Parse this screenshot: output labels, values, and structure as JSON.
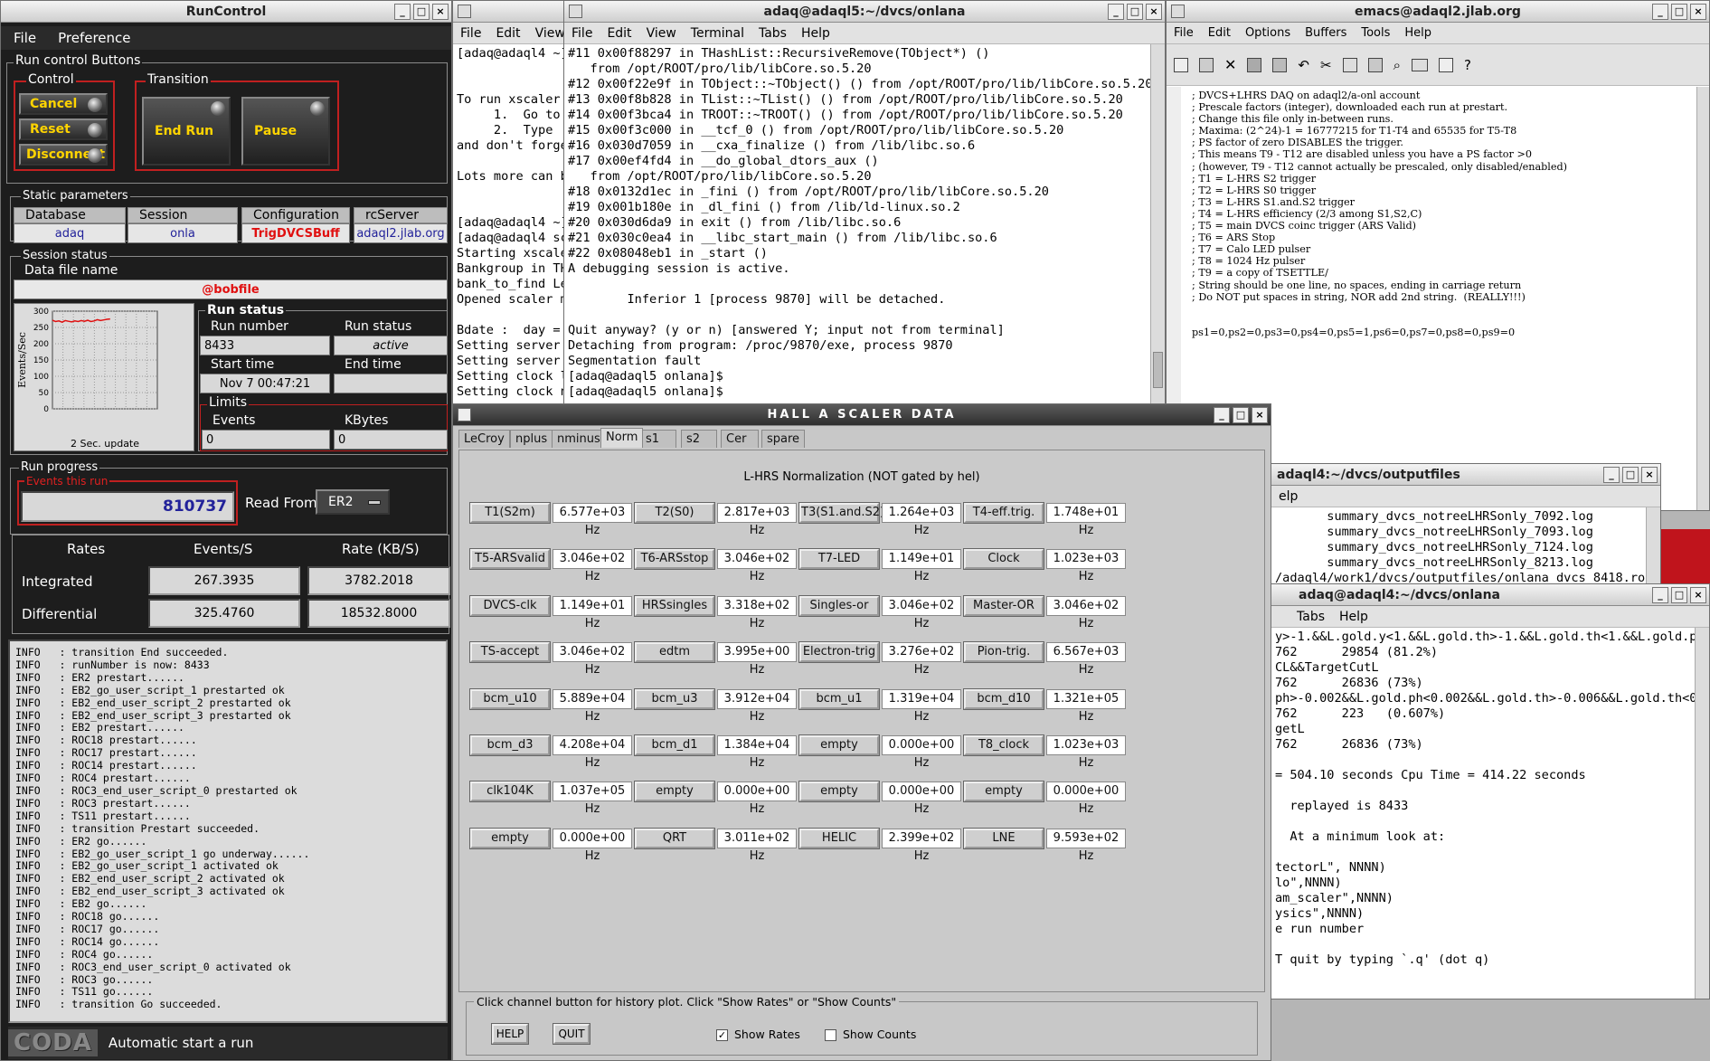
{
  "runcontrol": {
    "title": "RunControl",
    "menu": [
      "File",
      "Preference"
    ],
    "control_buttons_label": "Run control Buttons",
    "control_label": "Control",
    "transition_label": "Transition",
    "cancel": "Cancel",
    "reset": "Reset",
    "disconnect": "Disconnect",
    "end_run": "End Run",
    "pause": "Pause",
    "static_label": "Static parameters",
    "static_headers": [
      "Database",
      "Session",
      "Configuration",
      "rcServer"
    ],
    "static_values": [
      "adaq",
      "onla",
      "TrigDVCSBuff",
      "adaql2.jlab.org"
    ],
    "session_status": "Session status",
    "data_file_label": "Data file name",
    "data_file": "@bobfile",
    "chart_update": "2 Sec. update",
    "run_status_label": "Run status",
    "run_number_label": "Run number",
    "run_number": "8433",
    "run_status_hdr": "Run status",
    "run_status": "active",
    "start_time_label": "Start time",
    "start_time": "Nov 7 00:47:21",
    "end_time_label": "End time",
    "end_time": "",
    "limits_label": "Limits",
    "events_label": "Events",
    "events_val": "0",
    "kbytes_label": "KBytes",
    "kbytes_val": "0",
    "run_progress": "Run progress",
    "events_this_run_label": "Events this run",
    "events_this_run": "810737",
    "read_from_label": "Read From:",
    "read_from": "ER2",
    "rates_hdr": [
      "Rates",
      "Events/S",
      "Rate (KB/S)"
    ],
    "integrated": {
      "label": "Integrated",
      "events": "267.3935",
      "rate": "3782.2018"
    },
    "differential": {
      "label": "Differential",
      "events": "325.4760",
      "rate": "18532.8000"
    },
    "log": [
      "INFO   : transition End succeeded.",
      "INFO   : runNumber is now: 8433",
      "INFO   : ER2 prestart......",
      "INFO   : EB2_go_user_script_1 prestarted ok",
      "INFO   : EB2_end_user_script_2 prestarted ok",
      "INFO   : EB2_end_user_script_3 prestarted ok",
      "INFO   : EB2 prestart......",
      "INFO   : ROC18 prestart......",
      "INFO   : ROC17 prestart......",
      "INFO   : ROC14 prestart......",
      "INFO   : ROC4 prestart......",
      "INFO   : ROC3_end_user_script_0 prestarted ok",
      "INFO   : ROC3 prestart......",
      "INFO   : TS11 prestart......",
      "INFO   : transition Prestart succeeded.",
      "INFO   : ER2 go......",
      "INFO   : EB2_go_user_script_1 go underway......",
      "INFO   : EB2_go_user_script_1 activated ok",
      "INFO   : EB2_end_user_script_2 activated ok",
      "INFO   : EB2_end_user_script_3 activated ok",
      "INFO   : EB2 go......",
      "INFO   : ROC18 go......",
      "INFO   : ROC17 go......",
      "INFO   : ROC14 go......",
      "INFO   : ROC4 go......",
      "INFO   : ROC3_end_user_script_0 activated ok",
      "INFO   : ROC3 go......",
      "INFO   : TS11 go......",
      "INFO   : transition Go succeeded."
    ],
    "coda": "CODA",
    "status_msg": "Automatic start a run"
  },
  "chart_data": {
    "type": "line",
    "ylabel": "Events/Sec",
    "xlabel": "2 Sec. update",
    "ylim": [
      0,
      300
    ],
    "yticks": [
      "300",
      "250",
      "200",
      "150",
      "100",
      "50",
      "0"
    ],
    "series": [
      {
        "values": [
          272,
          268,
          270,
          266,
          271,
          269,
          267,
          270,
          268,
          271,
          269,
          272,
          268,
          270,
          274,
          271,
          273,
          275,
          276
        ]
      }
    ]
  },
  "term_bg": {
    "title": "",
    "menu": [
      "File",
      "Edit",
      "View"
    ],
    "lines": [
      "[adaq@adaql4 ~]",
      "",
      "",
      "To run xscaler",
      "     1.  Go to",
      "     2.  Type '",
      "and don't forge",
      "",
      "Lots more can b",
      "",
      "",
      "[adaq@adaql4 ~]",
      "[adaq@adaql4 sc",
      "Starting xscale",
      "Bankgroup in TH",
      "bank_to_find Le",
      "Opened scaler m",
      "",
      "Bdate :  day =",
      "Setting server",
      "Setting server",
      "Setting clock l",
      "Setting clock n"
    ]
  },
  "term_main": {
    "title": "adaq@adaql5:~/dvcs/onlana",
    "menu": [
      "File",
      "Edit",
      "View",
      "Terminal",
      "Tabs",
      "Help"
    ],
    "lines": [
      "#11 0x00f88297 in THashList::RecursiveRemove(TObject*) ()",
      "   from /opt/ROOT/pro/lib/libCore.so.5.20",
      "#12 0x00f22e9f in TObject::~TObject() () from /opt/ROOT/pro/lib/libCore.so.5.20",
      "#13 0x00f8b828 in TList::~TList() () from /opt/ROOT/pro/lib/libCore.so.5.20",
      "#14 0x00f3bca4 in TROOT::~TROOT() () from /opt/ROOT/pro/lib/libCore.so.5.20",
      "#15 0x00f3c000 in __tcf_0 () from /opt/ROOT/pro/lib/libCore.so.5.20",
      "#16 0x030d7059 in __cxa_finalize () from /lib/libc.so.6",
      "#17 0x00ef4fd4 in __do_global_dtors_aux ()",
      "   from /opt/ROOT/pro/lib/libCore.so.5.20",
      "#18 0x0132d1ec in _fini () from /opt/ROOT/pro/lib/libCore.so.5.20",
      "#19 0x001b180e in _dl_fini () from /lib/ld-linux.so.2",
      "#20 0x030d6da9 in exit () from /lib/libc.so.6",
      "#21 0x030c0ea4 in __libc_start_main () from /lib/libc.so.6",
      "#22 0x08048eb1 in _start ()",
      "A debugging session is active.",
      "",
      "        Inferior 1 [process 9870] will be detached.",
      "",
      "Quit anyway? (y or n) [answered Y; input not from terminal]",
      "Detaching from program: /proc/9870/exe, process 9870",
      "Segmentation fault",
      "[adaq@adaql5 onlana]$",
      "[adaq@adaql5 onlana]$"
    ]
  },
  "emacs": {
    "title": "emacs@adaql2.jlab.org",
    "menu": [
      "File",
      "Edit",
      "Options",
      "Buffers",
      "Tools",
      "Help"
    ],
    "lines": [
      "; DVCS+LHRS DAQ on adaql2/a-onl account",
      "; Prescale factors (integer), downloaded each run at prestart.",
      "; Change this file only in-between runs.",
      "; Maxima: (2^24)-1 = 16777215 for T1-T4 and 65535 for T5-T8",
      "; PS factor of zero DISABLES the trigger.",
      "; This means T9 - T12 are disabled unless you have a PS factor >0",
      "; (however, T9 - T12 cannot actually be prescaled, only disabled/enabled)",
      "; T1 = L-HRS S2 trigger",
      "; T2 = L-HRS S0 trigger",
      "; T3 = L-HRS S1.and.S2 trigger",
      "; T4 = L-HRS efficiency (2/3 among S1,S2,C)",
      "; T5 = main DVCS coinc trigger (ARS Valid)",
      "; T6 = ARS Stop",
      "; T7 = Calo LED pulser",
      "; T8 = 1024 Hz pulser",
      "; T9 = a copy of TSETTLE/",
      "; String should be one line, no spaces, ending in carriage return",
      "; Do NOT put spaces in string, NOR add 2nd string.  (REALLY!!!)",
      "",
      "",
      "ps1=0,ps2=0,ps3=0,ps4=0,ps5=1,ps6=0,ps7=0,ps8=0,ps9=0"
    ]
  },
  "outputfiles": {
    "title": "adaql4:~/dvcs/outputfiles",
    "menu": [
      "elp"
    ],
    "lines": [
      "       summary_dvcs_notreeLHRSonly_7092.log",
      "       summary_dvcs_notreeLHRSonly_7093.log",
      "       summary_dvcs_notreeLHRSonly_7124.log",
      "       summary_dvcs_notreeLHRSonly_8213.log",
      "/adaql4/work1/dvcs/outputfiles/onlana_dvcs_8418.ro"
    ]
  },
  "term_right": {
    "title": "adaq@adaql4:~/dvcs/onlana",
    "menu": [
      "Tabs",
      "Help"
    ],
    "lines": [
      "y>-1.&&L.gold.y<1.&&L.gold.th>-1.&&L.gold.th<1.&&L.gold.ph",
      "762      29854 (81.2%)",
      "CL&&TargetCutL",
      "762      26836 (73%)",
      "ph>-0.002&&L.gold.ph<0.002&&L.gold.th>-0.006&&L.gold.th<0.",
      "762      223   (0.607%)",
      "getL",
      "762      26836 (73%)",
      "",
      "= 504.10 seconds Cpu Time = 414.22 seconds",
      "",
      "  replayed is 8433",
      "",
      "  At a minimum look at:",
      "",
      "tectorL\", NNNN)",
      "lo\",NNNN)",
      "am_scaler\",NNNN)",
      "ysics\",NNNN)",
      "e run number",
      "",
      "T quit by typing `.q' (dot q)"
    ]
  },
  "scaler": {
    "title": "HALL  A  SCALER  DATA",
    "tabs": [
      "LeCroy",
      "nplus",
      "nminus",
      "Norm",
      "s1",
      "s2",
      "Cer",
      "spare"
    ],
    "active_tab": "Norm",
    "heading": "L-HRS Normalization (NOT gated by hel)",
    "rows": [
      [
        [
          "T1(S2m)",
          "6.577e+03 Hz"
        ],
        [
          "T2(S0)",
          "2.817e+03 Hz"
        ],
        [
          "T3(S1.and.S2)",
          "1.264e+03 Hz"
        ],
        [
          "T4-eff.trig.",
          "1.748e+01 Hz"
        ]
      ],
      [
        [
          "T5-ARSvalid",
          "3.046e+02 Hz"
        ],
        [
          "T6-ARSstop",
          "3.046e+02 Hz"
        ],
        [
          "T7-LED",
          "1.149e+01 Hz"
        ],
        [
          "Clock",
          "1.023e+03 Hz"
        ]
      ],
      [
        [
          "DVCS-clk",
          "1.149e+01 Hz"
        ],
        [
          "HRSsingles",
          "3.318e+02 Hz"
        ],
        [
          "Singles-or",
          "3.046e+02 Hz"
        ],
        [
          "Master-OR",
          "3.046e+02 Hz"
        ]
      ],
      [
        [
          "TS-accept",
          "3.046e+02 Hz"
        ],
        [
          "edtm",
          "3.995e+00 Hz"
        ],
        [
          "Electron-trig",
          "3.276e+02 Hz"
        ],
        [
          "Pion-trig.",
          "6.567e+03 Hz"
        ]
      ],
      [
        [
          "bcm_u10",
          "5.889e+04 Hz"
        ],
        [
          "bcm_u3",
          "3.912e+04 Hz"
        ],
        [
          "bcm_u1",
          "1.319e+04 Hz"
        ],
        [
          "bcm_d10",
          "1.321e+05 Hz"
        ]
      ],
      [
        [
          "bcm_d3",
          "4.208e+04 Hz"
        ],
        [
          "bcm_d1",
          "1.384e+04 Hz"
        ],
        [
          "empty",
          "0.000e+00 Hz"
        ],
        [
          "T8_clock",
          "1.023e+03 Hz"
        ]
      ],
      [
        [
          "clk104K",
          "1.037e+05 Hz"
        ],
        [
          "empty",
          "0.000e+00 Hz"
        ],
        [
          "empty",
          "0.000e+00 Hz"
        ],
        [
          "empty",
          "0.000e+00 Hz"
        ]
      ],
      [
        [
          "empty",
          "0.000e+00 Hz"
        ],
        [
          "QRT",
          "3.011e+02 Hz"
        ],
        [
          "HELIC",
          "2.399e+02 Hz"
        ],
        [
          "LNE",
          "9.593e+02 Hz"
        ]
      ]
    ],
    "help_text": "Click channel button for history plot.  Click \"Show Rates\" or \"Show Counts\"",
    "help_btn": "HELP",
    "quit_btn": "QUIT",
    "show_rates": "Show Rates",
    "show_counts": "Show Counts"
  },
  "win_btns": {
    "min": "_",
    "max": "□",
    "close": "×"
  }
}
